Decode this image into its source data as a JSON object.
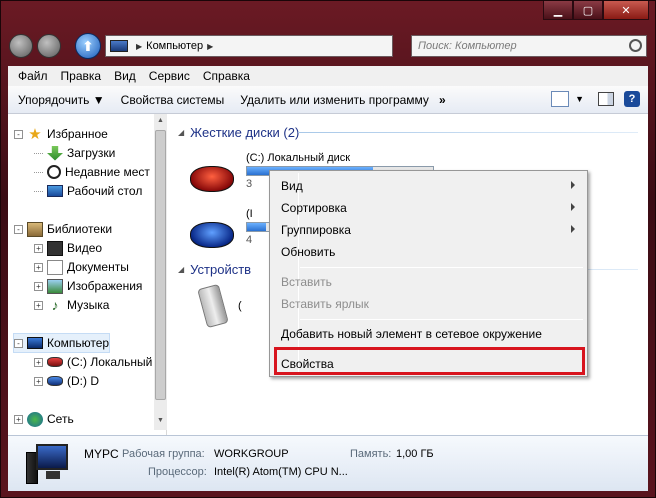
{
  "address": {
    "path": "Компьютер"
  },
  "search": {
    "placeholder": "Поиск: Компьютер"
  },
  "menubar": {
    "items": [
      "Файл",
      "Правка",
      "Вид",
      "Сервис",
      "Справка"
    ]
  },
  "toolbar": {
    "organize": "Упорядочить",
    "system_properties": "Свойства системы",
    "uninstall": "Удалить или изменить программу",
    "more": "»"
  },
  "nav": {
    "favorites": "Избранное",
    "downloads": "Загрузки",
    "recent": "Недавние мест",
    "desktop": "Рабочий стол",
    "libraries": "Библиотеки",
    "video": "Видео",
    "documents": "Документы",
    "images": "Изображения",
    "music": "Музыка",
    "computer": "Компьютер",
    "drive_c": "(C:) Локальный",
    "drive_d": "(D:) D",
    "network": "Сеть"
  },
  "main": {
    "hdd_group": "Жесткие диски (2)",
    "removable_group": "Устройств",
    "drive_c_name": "(C:) Локальный диск",
    "drive_c_sub": "3",
    "drive_c_fill": 0.68,
    "drive_d_name": "(I",
    "drive_d_sub": "4",
    "drive_d_fill": 0.1,
    "removable_name": "("
  },
  "context_menu": {
    "view": "Вид",
    "sort": "Сортировка",
    "group": "Группировка",
    "refresh": "Обновить",
    "paste": "Вставить",
    "paste_shortcut": "Вставить ярлык",
    "add_network": "Добавить новый элемент в сетевое окружение",
    "properties": "Свойства"
  },
  "details": {
    "name": "MYPC",
    "workgroup_label": "Рабочая группа:",
    "workgroup": "WORKGROUP",
    "memory_label": "Память:",
    "memory": "1,00 ГБ",
    "cpu_label": "Процессор:",
    "cpu": "Intel(R) Atom(TM) CPU N..."
  },
  "colors": {
    "highlight": "#d8141e",
    "group_header": "#1e3287"
  }
}
